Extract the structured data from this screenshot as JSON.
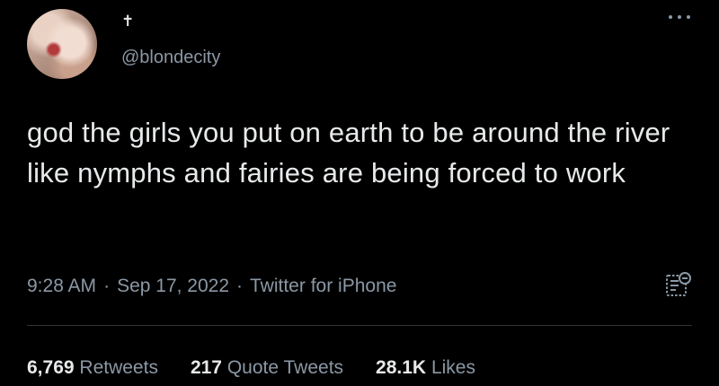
{
  "tweet": {
    "display_name": "✝",
    "handle": "@blondecity",
    "text": "god the girls you put on earth to be around the river like nymphs and fairies are being forced to work",
    "time": "9:28 AM",
    "date": "Sep 17, 2022",
    "source": "Twitter for iPhone",
    "separator": "·"
  },
  "stats": {
    "retweets_count": "6,769",
    "retweets_label": "Retweets",
    "quotes_count": "217",
    "quotes_label": "Quote Tweets",
    "likes_count": "28.1K",
    "likes_label": "Likes"
  },
  "icons": {
    "more": "more-options-icon",
    "analytics": "view-tweet-analytics-icon"
  },
  "colors": {
    "background": "#000000",
    "text_primary": "#e7e9ea",
    "text_secondary": "#8b98a5",
    "divider": "#2f3336"
  }
}
